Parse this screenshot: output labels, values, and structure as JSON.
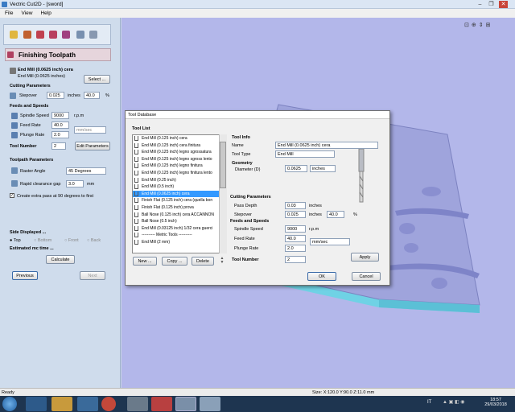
{
  "window": {
    "title": "Vectric Cut2D - [sword]",
    "min": "–",
    "max": "❐",
    "close": "✕"
  },
  "menu": [
    "File",
    "View",
    "Help"
  ],
  "panel": {
    "heading": "Finishing Toolpath",
    "tool_name": "End Mill (0.0625 inch) cera",
    "tool_sub": "End Mill (0.0625 inches)",
    "select_btn": "Select ...",
    "cutting_params": "Cutting Parameters",
    "stepover_lbl": "Stepover",
    "stepover_val": "0.025",
    "stepover_unit": "inches",
    "stepover_pct": "40.0",
    "pct": "%",
    "feeds_speeds": "Feeds and Speeds",
    "spindle_lbl": "Spindle Speed",
    "spindle_val": "9000",
    "spindle_unit": "r.p.m",
    "feed_lbl": "Feed Rate",
    "feed_val": "40.0",
    "plunge_lbl": "Plunge Rate",
    "plunge_val": "2.0",
    "rate_unit": "mm/sec",
    "toolnum_lbl": "Tool Number",
    "toolnum_val": "2",
    "edit_params": "Edit Parameters",
    "toolpath_params": "Toolpath Parameters",
    "raster_lbl": "Raster Angle",
    "raster_val": "45 Degrees",
    "rapid_lbl": "Rapid clearance gap",
    "rapid_val": "3.0",
    "rapid_unit": "mm",
    "extra_pass": "Create extra pass at 90 degrees to first",
    "side_displayed": "Side Displayed ...",
    "sides": [
      "Top",
      "Bottom",
      "Front",
      "Back"
    ],
    "estimated": "Estimated mc time ...",
    "calculate": "Calculate",
    "previous": "Previous",
    "next": "Next"
  },
  "dialog": {
    "title": "Tool Database",
    "tool_list": "Tool List",
    "tools": [
      "End Mill (0.125 inch) cera",
      "End Mill (0.125 inch) cera finitura",
      "End Mill (0.125 inch) legno sgrossatura",
      "End Mill (0.125 inch) legno sgross lento",
      "End Mill (0.125 inch) legno finitura",
      "End Mill (0.125 inch) legno finitura lento",
      "End Mill (0.25 inch)",
      "End Mill (0.5 inch)",
      "End Mill (0.0625 inch) cera",
      "Finish Flat (0.125 inch) cera (quella bon",
      "Finish Flat (0.125 inch) prova",
      "Ball Nose (0.125 inch) cera ACCANNON",
      "Ball Nose (0.5 inch)",
      "End Mill (0.03125 inch) 1/32 cera guerci",
      "---------- Metric Tools ----------",
      "End Mill (2 mm)"
    ],
    "selected_index": 8,
    "new_btn": "New ...",
    "copy_btn": "Copy ...",
    "delete_btn": "Delete",
    "tool_info": "Tool Info",
    "name_lbl": "Name",
    "name_val": "End Mill (0.0625 inch) cera",
    "type_lbl": "Tool Type",
    "type_val": "End Mill",
    "geometry": "Geometry",
    "diameter_lbl": "Diameter (D)",
    "diameter_val": "0.0625",
    "diameter_unit": "inches",
    "cutting_params": "Cutting Parameters",
    "pass_lbl": "Pass Depth",
    "pass_val": "0.03",
    "pass_unit": "inches",
    "step_lbl": "Stepover",
    "step_val": "0.025",
    "step_unit": "inches",
    "step_pct": "40.0",
    "pct": "%",
    "feeds_speeds": "Feeds and Speeds",
    "spindle_lbl": "Spindle Speed",
    "spindle_val": "9000",
    "spindle_unit": "r.p.m",
    "feed_lbl": "Feed Rate",
    "feed_val": "40.0",
    "feed_unit": "mm/sec",
    "plunge_lbl": "Plunge Rate",
    "plunge_val": "2.0",
    "toolnum_lbl": "Tool Number",
    "toolnum_val": "2",
    "apply": "Apply",
    "ok": "OK",
    "cancel": "Cancel"
  },
  "status": {
    "left": "Ready",
    "size": "Size: X:120.0 Y:90.0 Z:11.0 mm"
  },
  "taskbar": {
    "lang": "IT",
    "time": "18:57",
    "date": "29/03/2018"
  }
}
